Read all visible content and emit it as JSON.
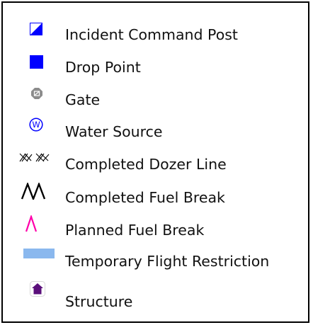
{
  "legend": {
    "items": [
      {
        "label": "Incident Command Post",
        "icon": "incident-command-post-icon",
        "color": "#0000ff"
      },
      {
        "label": "Drop Point",
        "icon": "drop-point-icon",
        "color": "#0000ff"
      },
      {
        "label": "Gate",
        "icon": "gate-icon",
        "color": "#8c8c8c"
      },
      {
        "label": "Water Source",
        "icon": "water-source-icon",
        "color": "#0000ff"
      },
      {
        "label": "Completed Dozer Line",
        "icon": "completed-dozer-line-icon",
        "color": "#000000"
      },
      {
        "label": "Completed Fuel Break",
        "icon": "completed-fuel-break-icon",
        "color": "#000000"
      },
      {
        "label": "Planned Fuel Break",
        "icon": "planned-fuel-break-icon",
        "color": "#ff00aa"
      },
      {
        "label": "Temporary Flight Restriction",
        "icon": "temporary-flight-restriction-icon",
        "color": "#8ab8ee"
      },
      {
        "label": "Structure",
        "icon": "structure-icon",
        "color": "#5a0f7a"
      }
    ]
  }
}
